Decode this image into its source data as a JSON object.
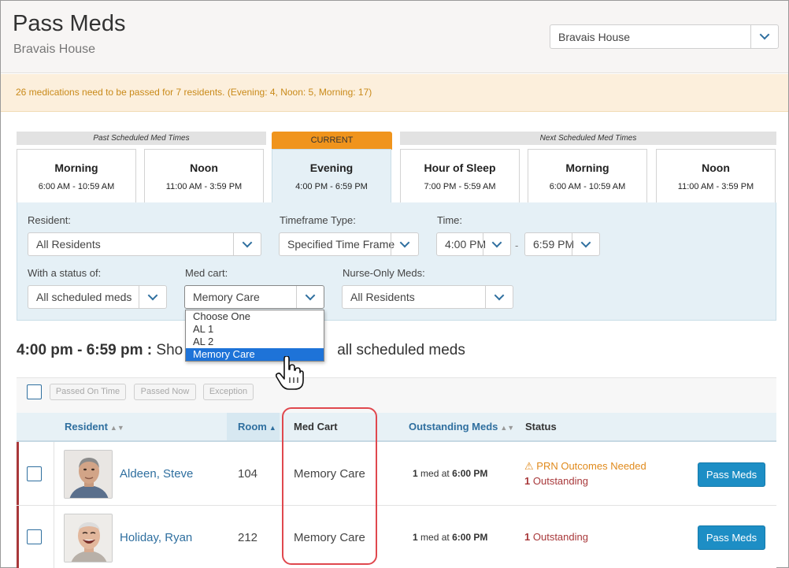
{
  "header": {
    "title": "Pass Meds",
    "subtitle": "Bravais House",
    "facility_select": "Bravais House"
  },
  "alert": "26 medications need to be passed for 7 residents. (Evening: 4, Noon: 5, Morning: 17)",
  "timeframes": {
    "past_label": "Past Scheduled Med Times",
    "current_label": "CURRENT",
    "next_label": "Next Scheduled Med Times",
    "cards": [
      {
        "name": "Morning",
        "time": "6:00 AM - 10:59 AM"
      },
      {
        "name": "Noon",
        "time": "11:00 AM - 3:59 PM"
      },
      {
        "name": "Evening",
        "time": "4:00 PM - 6:59 PM"
      },
      {
        "name": "Hour of Sleep",
        "time": "7:00 PM - 5:59 AM"
      },
      {
        "name": "Morning",
        "time": "6:00 AM - 10:59 AM"
      },
      {
        "name": "Noon",
        "time": "11:00 AM - 3:59 PM"
      }
    ]
  },
  "filters": {
    "resident_label": "Resident:",
    "resident_value": "All Residents",
    "timeframe_type_label": "Timeframe Type:",
    "timeframe_type_value": "Specified Time Frame",
    "time_label": "Time:",
    "time_from": "4:00 PM",
    "time_dash": "-",
    "time_to": "6:59 PM",
    "status_label": "With a status of:",
    "status_value": "All scheduled meds",
    "medcart_label": "Med cart:",
    "medcart_value": "Memory Care",
    "medcart_options": [
      "Choose One",
      "AL 1",
      "AL 2",
      "Memory Care"
    ],
    "nurse_only_label": "Nurse-Only Meds:",
    "nurse_only_value": "All Residents"
  },
  "heading": {
    "time": "4:00 pm - 6:59 pm :",
    "text_left": "Sho",
    "text_right": "all scheduled meds"
  },
  "toolbar": {
    "passed_on_time": "Passed On Time",
    "passed_now": "Passed Now",
    "exception": "Exception"
  },
  "table": {
    "columns": {
      "resident": "Resident",
      "room": "Room",
      "med_cart": "Med Cart",
      "outstanding": "Outstanding Meds",
      "status": "Status"
    },
    "rows": [
      {
        "name": "Aldeen, Steve",
        "room": "104",
        "med_cart": "Memory Care",
        "meds_count": "1",
        "meds_mid": "med at",
        "meds_time": "6:00 PM",
        "status_warning": "PRN Outcomes Needed",
        "outstanding_count": "1",
        "outstanding_label": "Outstanding",
        "action": "Pass Meds"
      },
      {
        "name": "Holiday, Ryan",
        "room": "212",
        "med_cart": "Memory Care",
        "meds_count": "1",
        "meds_mid": "med at",
        "meds_time": "6:00 PM",
        "outstanding_count": "1",
        "outstanding_label": "Outstanding",
        "action": "Pass Meds"
      }
    ]
  },
  "colors": {
    "accent_blue": "#2f6f9f",
    "current_orange": "#f0941c",
    "alert_text": "#c98a1a",
    "button_blue": "#1d8ec5",
    "outstanding_red": "#a8383a",
    "highlight_red": "#e0484e"
  },
  "icons": [
    "chevron-down-icon",
    "warning-icon",
    "sort-icon",
    "hand-cursor-icon"
  ]
}
